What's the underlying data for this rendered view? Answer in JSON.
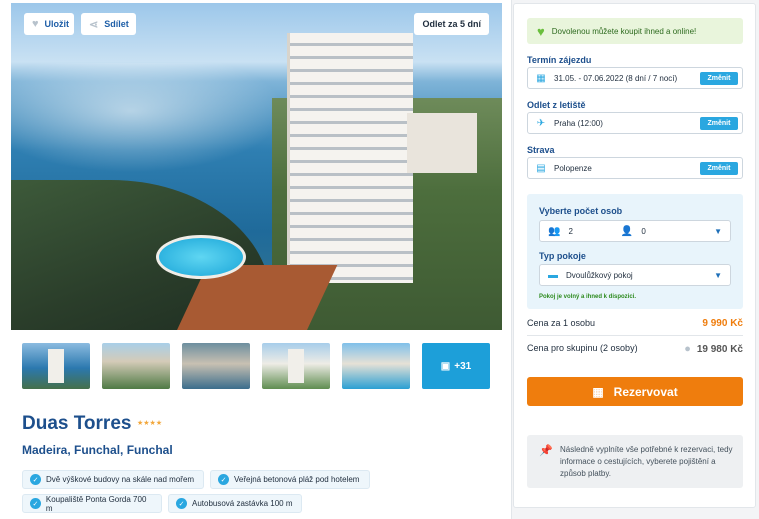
{
  "gallery": {
    "save_label": "Uložit",
    "share_label": "Sdílet",
    "flight_badge": "Odlet za 5 dní",
    "more_photos": "+31"
  },
  "hotel": {
    "name": "Duas Torres",
    "stars": 4,
    "stars_glyph": "★★★★",
    "location": "Madeira, Funchal, Funchal",
    "features": [
      "Dvě výškové budovy na skále nad mořem",
      "Veřejná betonová pláž pod hotelem",
      "Koupaliště Ponta Gorda 700 m",
      "Autobusová zastávka 100 m"
    ]
  },
  "booking": {
    "notice": "Dovolenou můžete koupit ihned a online!",
    "term_label": "Termín zájezdu",
    "term_value": "31.05. - 07.06.2022 (8 dní / 7 nocí)",
    "airport_label": "Odlet z letiště",
    "airport_value": "Praha (12:00)",
    "board_label": "Strava",
    "board_value": "Polopenze",
    "change_label": "Změnit",
    "persons_label": "Vyberte počet osob",
    "adults": "2",
    "children": "0",
    "room_label": "Typ pokoje",
    "room_value": "Dvoulůžkový pokoj",
    "availability": "Pokoj je volný a ihned k dispozici.",
    "price_per_person_label": "Cena za 1 osobu",
    "price_per_person": "9 990 Kč",
    "price_group_label": "Cena pro skupinu (2 osoby)",
    "price_group": "19 980 Kč",
    "book_label": "Rezervovat",
    "hint": "Následně vyplníte vše potřebné k rezervaci, tedy informace o cestujících, vyberete pojištění a způsob platby."
  },
  "colors": {
    "accent_blue": "#2aa7e0",
    "title_blue": "#1d4f8c",
    "orange": "#ef7d0d",
    "green": "#6abf3d"
  }
}
